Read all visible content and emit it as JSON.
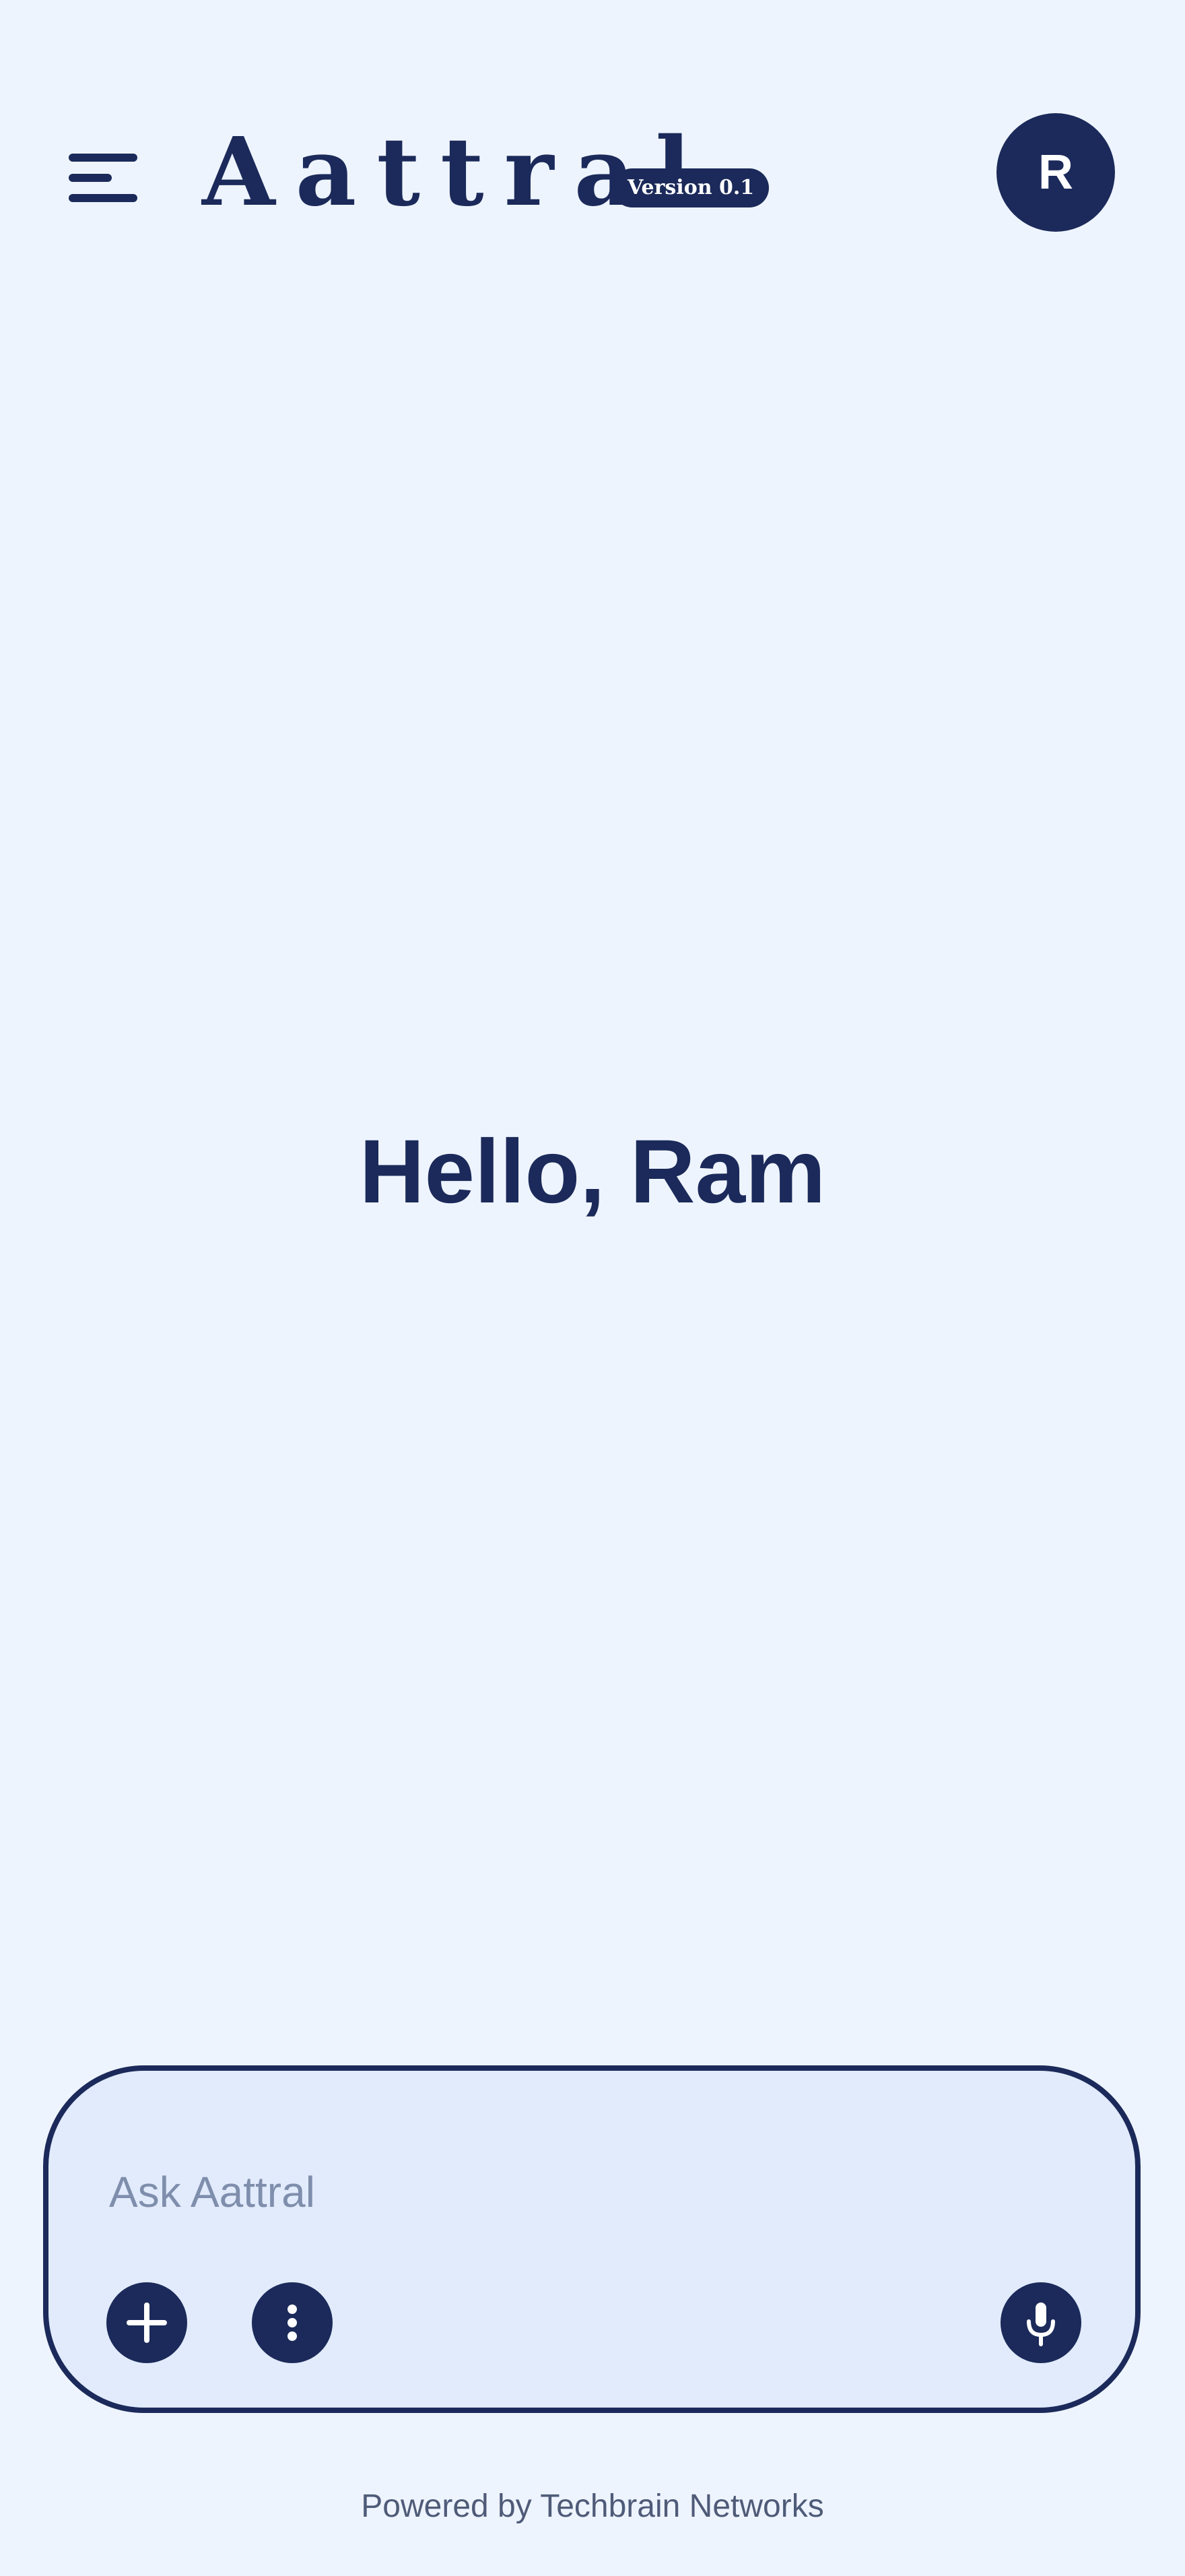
{
  "header": {
    "menu_icon": "hamburger-menu-icon",
    "logo_text": "Aattral",
    "version_badge": "Version 0.1",
    "avatar_initial": "R"
  },
  "main": {
    "greeting": "Hello, Ram"
  },
  "composer": {
    "placeholder": "Ask Aattral",
    "value": "",
    "buttons": {
      "add_icon": "plus-icon",
      "more_icon": "more-vertical-icon",
      "mic_icon": "microphone-icon"
    }
  },
  "footer": {
    "text": "Powered by Techbrain Networks"
  },
  "colors": {
    "background": "#eef4fe",
    "primary": "#1b2a5a",
    "composer_background": "#e1ebfc",
    "placeholder": "#7f8eac",
    "footer_text": "#4f5b78"
  }
}
